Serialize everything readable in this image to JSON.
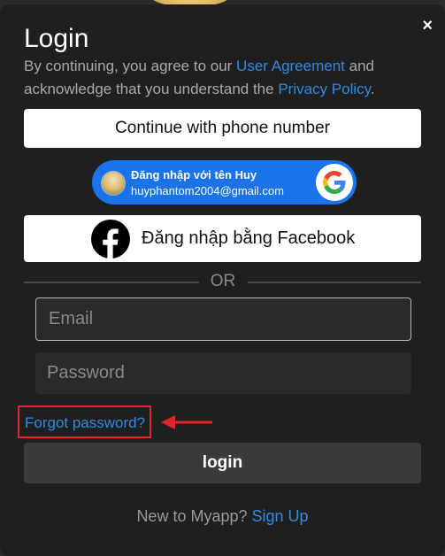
{
  "modal": {
    "close_symbol": "×",
    "title": "Login",
    "subtitle_prefix": "By continuing, you agree to our ",
    "user_agreement_link": "User Agreement",
    "subtitle_middle": " and acknowledge that you understand the ",
    "privacy_link": "Privacy Policy",
    "subtitle_suffix": "."
  },
  "buttons": {
    "phone": "Continue with phone number",
    "facebook": "Đăng nhập bằng Facebook",
    "login": "login"
  },
  "google": {
    "name_line": "Đăng nhập với tên Huy",
    "email": "huyphantom2004@gmail.com",
    "brand_color": "#1a73e8"
  },
  "divider": {
    "text": "OR"
  },
  "inputs": {
    "email_placeholder": "Email",
    "password_placeholder": "Password"
  },
  "forgot": {
    "label": "Forgot password?",
    "highlight_color": "#e0262b"
  },
  "signup": {
    "prompt": "New to Myapp? ",
    "link": "Sign Up"
  },
  "colors": {
    "link": "#2f8ae0",
    "background": "#1f1f1f",
    "facebook": "#000000"
  },
  "icons": {
    "close": "close-icon",
    "google": "google-g-icon",
    "facebook": "facebook-icon",
    "arrow": "arrow-left-icon"
  }
}
